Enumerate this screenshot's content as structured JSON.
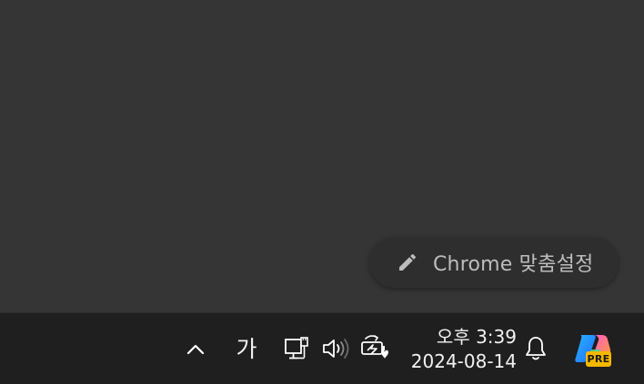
{
  "browser": {
    "customize_button": {
      "label": "Chrome 맞춤설정",
      "icon": "pencil-icon"
    }
  },
  "taskbar": {
    "overflow_icon": "chevron-up-icon",
    "ime_indicator": "가",
    "network_icon": "wired-network-icon",
    "volume_icon": "speaker-icon",
    "battery_icon": "battery-saver-icon",
    "clock": {
      "time": "오후 3:39",
      "date": "2024-08-14"
    },
    "notification_icon": "bell-icon",
    "copilot": {
      "icon": "copilot-icon",
      "badge": "PRE"
    }
  },
  "colors": {
    "page_background": "#353535",
    "taskbar_background": "#1f1f1f",
    "chip_background": "#2e2e2e",
    "chip_text": "#bdbdbd",
    "badge_yellow": "#f5b800"
  }
}
